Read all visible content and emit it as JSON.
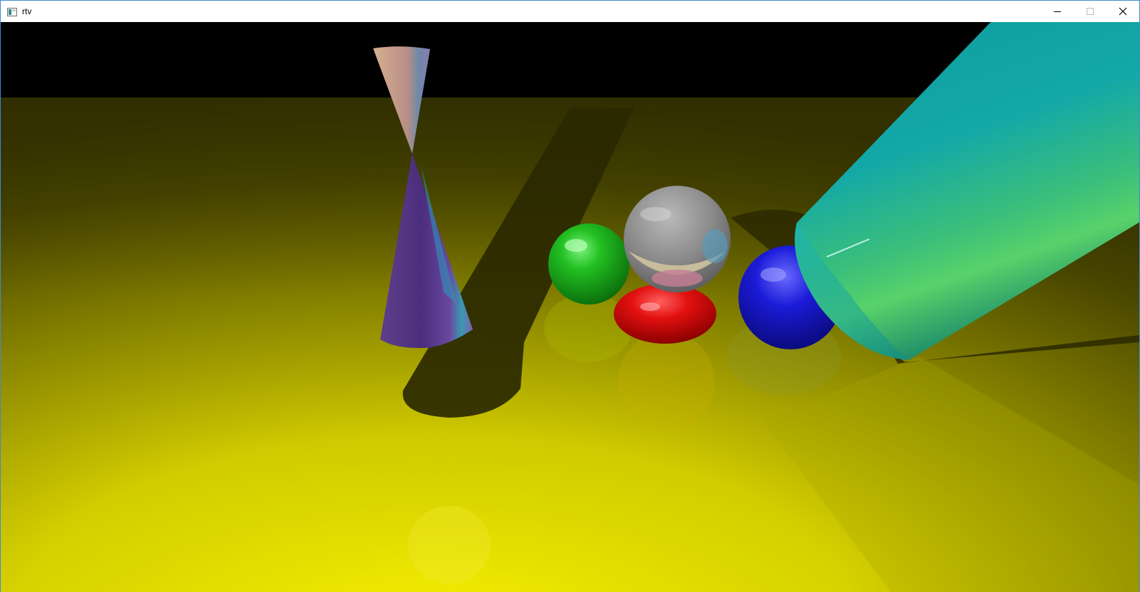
{
  "window": {
    "title": "rtv",
    "icon": "app-window-icon",
    "controls": [
      "minimize-icon",
      "maximize-icon",
      "close-icon"
    ]
  },
  "scene": {
    "type": "raytraced-render",
    "background_color": "#000000",
    "floor_color": "#e5e000",
    "objects": [
      {
        "kind": "double-cone",
        "colors": [
          "#c8a07f",
          "#5d3a8c"
        ]
      },
      {
        "kind": "sphere",
        "color": "#1bb31b"
      },
      {
        "kind": "sphere",
        "color": "#8a8a8a"
      },
      {
        "kind": "sphere",
        "color": "#e00000"
      },
      {
        "kind": "sphere",
        "color": "#1a1ad6"
      },
      {
        "kind": "cylinder",
        "color": "#14a8a8"
      }
    ]
  }
}
